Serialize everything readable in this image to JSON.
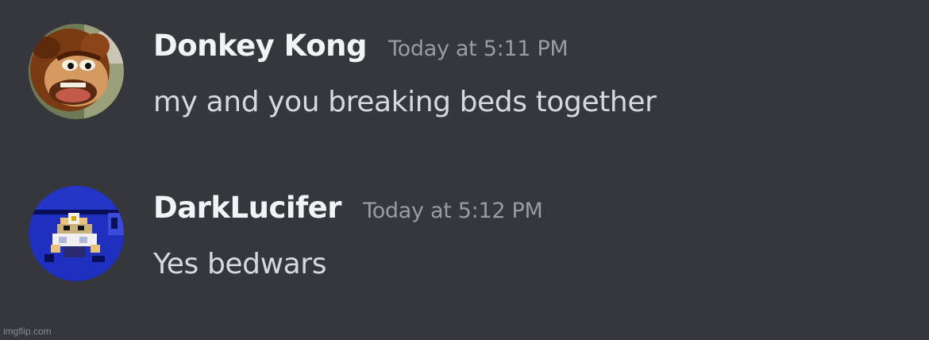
{
  "messages": [
    {
      "username": "Donkey Kong",
      "timestamp": "Today at 5:11 PM",
      "content": "my and you breaking beds together",
      "avatar_icon": "donkey-kong-avatar"
    },
    {
      "username": "DarkLucifer",
      "timestamp": "Today at 5:12 PM",
      "content": "Yes bedwars",
      "avatar_icon": "pixel-character-avatar"
    }
  ],
  "watermark": "imgflip.com",
  "colors": {
    "background": "#36373d",
    "username": "#f2f3f5",
    "timestamp": "#9a9ca3",
    "content": "#d8d9de"
  }
}
